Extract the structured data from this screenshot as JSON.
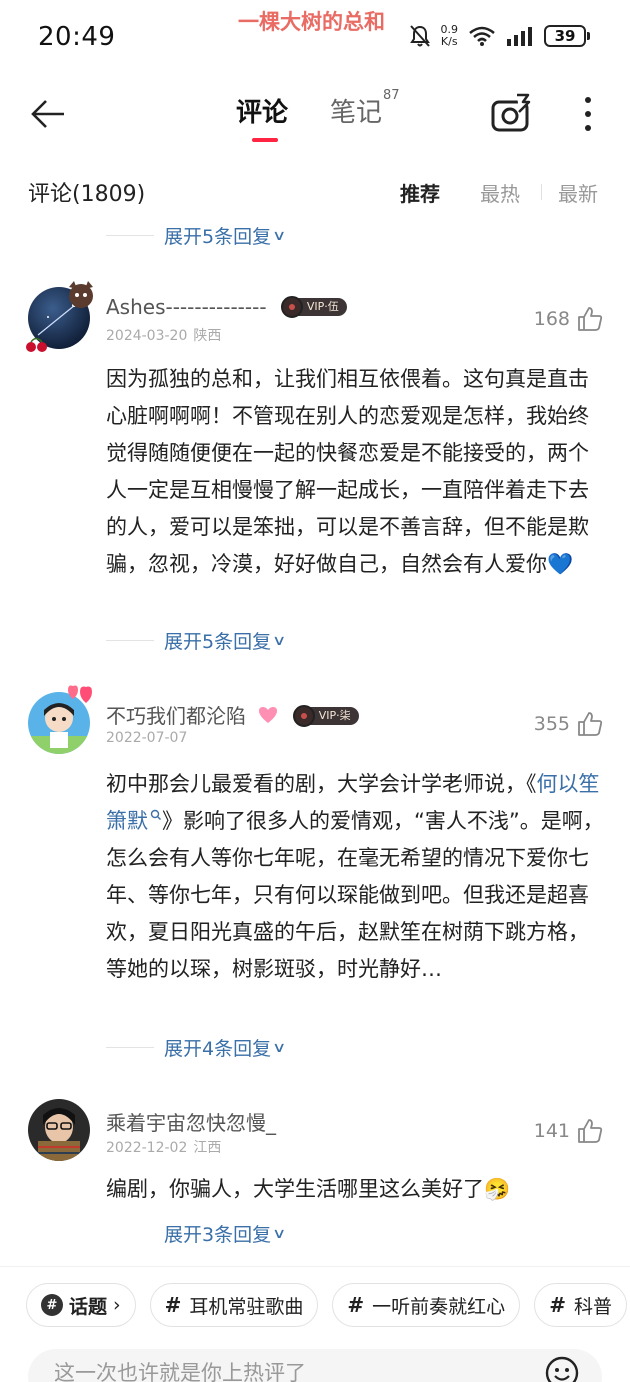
{
  "status_bar": {
    "time": "20:49",
    "marquee": "一棵大树的总和",
    "net_speed_value": "0.9",
    "net_speed_unit": "K/s",
    "battery": "39"
  },
  "header": {
    "tab_comments": "评论",
    "tab_notes": "笔记",
    "tab_notes_count": "87"
  },
  "comments_header": {
    "count_label": "评论(1809)",
    "sort_recommend": "推荐",
    "sort_hot": "最热",
    "sort_new": "最新"
  },
  "top_expand": "展开5条回复",
  "comments": [
    {
      "username": "Ashes--------------",
      "vip": "VIP·伍",
      "date": "2024-03-20",
      "location": "陕西",
      "likes": "168",
      "text": "因为孤独的总和，让我们相互依偎着。这句真是直击心脏啊啊啊！不管现在别人的恋爱观是怎样，我始终觉得随随便便在一起的快餐恋爱是不能接受的，两个人一定是互相慢慢了解一起成长，一直陪伴着走下去的人，爱可以是笨拙，可以是不善言辞，但不能是欺骗，忽视，冷漠，好好做自己，自然会有人爱你💙",
      "expand": "展开5条回复"
    },
    {
      "username": "不巧我们都沦陷",
      "vip": "VIP·柒",
      "date": "2022-07-07",
      "location": "",
      "likes": "355",
      "text_before": "初中那会儿最爱看的剧，大学会计学老师说，《",
      "link": "何以笙箫默",
      "text_after": "》影响了很多人的爱情观，“害人不浅”。是啊，怎么会有人等你七年呢，在毫无希望的情况下爱你七年、等你七年，只有何以琛能做到吧。但我还是超喜欢，夏日阳光真盛的午后，赵默笙在树荫下跳方格，等她的以琛，树影斑驳，时光静好…",
      "expand": "展开4条回复"
    },
    {
      "username": "乘着宇宙忽快忽慢_",
      "date": "2022-12-02",
      "location": "江西",
      "likes": "141",
      "text": "编剧，你骗人，大学生活哪里这么美好了🤧",
      "expand": "展开3条回复"
    }
  ],
  "topics": {
    "topic_label": "话题",
    "chip1": "耳机常驻歌曲",
    "chip2": "一听前奏就红心",
    "chip3": "科普"
  },
  "input": {
    "placeholder": "这一次也许就是你上热评了"
  },
  "colors": {
    "accent": "#ff2442",
    "link": "#3a6fa8"
  },
  "icons": [
    "back-arrow-icon",
    "camera-icon",
    "more-icon",
    "thumbs-up-icon",
    "chevron-down-icon",
    "topic-icon",
    "emoji-icon",
    "wifi-icon",
    "signal-icon",
    "battery-icon",
    "mute-icon"
  ]
}
